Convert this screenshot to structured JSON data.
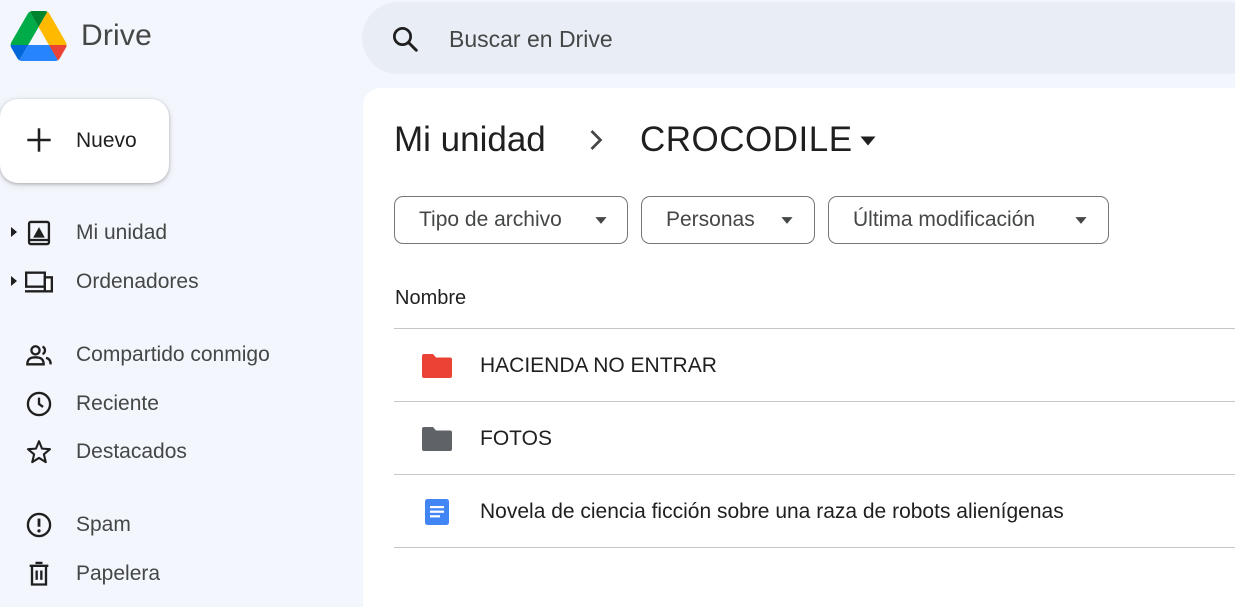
{
  "app": {
    "name": "Drive"
  },
  "search": {
    "placeholder": "Buscar en Drive"
  },
  "new_button": {
    "label": "Nuevo"
  },
  "sidebar": {
    "items": [
      {
        "label": "Mi unidad",
        "icon": "drive-icon",
        "expandable": true
      },
      {
        "label": "Ordenadores",
        "icon": "computers-icon",
        "expandable": true
      },
      {
        "label": "Compartido conmigo",
        "icon": "people-icon",
        "expandable": false
      },
      {
        "label": "Reciente",
        "icon": "clock-icon",
        "expandable": false
      },
      {
        "label": "Destacados",
        "icon": "star-icon",
        "expandable": false
      },
      {
        "label": "Spam",
        "icon": "spam-icon",
        "expandable": false
      },
      {
        "label": "Papelera",
        "icon": "trash-icon",
        "expandable": false
      }
    ]
  },
  "breadcrumb": {
    "root": "Mi unidad",
    "current": "CROCODILE"
  },
  "filters": [
    {
      "label": "Tipo de archivo"
    },
    {
      "label": "Personas"
    },
    {
      "label": "Última modificación"
    }
  ],
  "file_list": {
    "column_header": "Nombre",
    "rows": [
      {
        "name": "HACIENDA NO ENTRAR",
        "type": "folder",
        "icon": "folder-icon",
        "color": "#ea4335"
      },
      {
        "name": "FOTOS",
        "type": "folder",
        "icon": "folder-icon",
        "color": "#5f6368"
      },
      {
        "name": "Novela de ciencia ficción sobre una raza de robots alienígenas",
        "type": "document",
        "icon": "doc-icon",
        "color": "#4285f4"
      }
    ]
  },
  "colors": {
    "background": "#f3f6fc",
    "search_bg": "#e9eef6",
    "panel": "#ffffff",
    "text": "#1f1f1f",
    "secondary_text": "#444746"
  }
}
